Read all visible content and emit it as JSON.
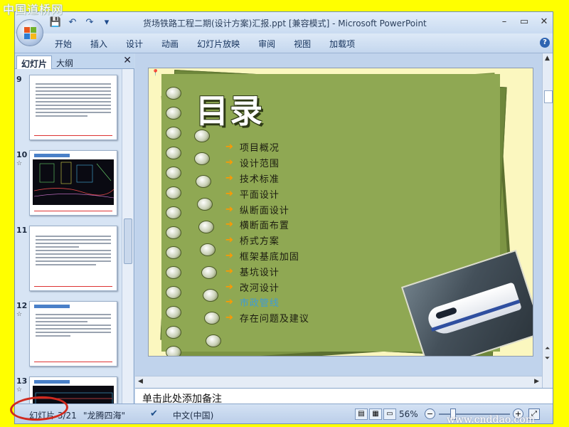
{
  "watermark": {
    "top_left": "中国道桥网",
    "bottom_right": "www.cnddao.com"
  },
  "window": {
    "title": "货场铁路工程二期(设计方案)汇报.ppt [兼容模式] - Microsoft PowerPoint",
    "controls": [
      "–",
      "▭",
      "✕"
    ]
  },
  "ribbon": {
    "tabs": [
      "开始",
      "插入",
      "设计",
      "动画",
      "幻灯片放映",
      "审阅",
      "视图",
      "加载项"
    ]
  },
  "pane": {
    "tabs": [
      "幻灯片",
      "大纲"
    ],
    "slides": [
      {
        "num": "9",
        "star": ""
      },
      {
        "num": "10",
        "star": "☆"
      },
      {
        "num": "11",
        "star": ""
      },
      {
        "num": "12",
        "star": "☆"
      },
      {
        "num": "13",
        "star": "☆"
      }
    ]
  },
  "slide": {
    "title": "目录",
    "items": [
      "项目概况",
      "设计范围",
      "技术标准",
      "平面设计",
      "纵断面设计",
      "横断面布置",
      "桥式方案",
      "框架基底加固",
      "基坑设计",
      "改河设计",
      "市政管线",
      "存在问题及建议"
    ],
    "current_index": 10
  },
  "notes": {
    "placeholder": "单击此处添加备注"
  },
  "status": {
    "slide": "幻灯片 3/21",
    "theme": "\"龙腾四海\"",
    "language": "中文(中国)",
    "zoom": "56%",
    "zoom_level": 0.2
  },
  "colors": {
    "accent_orange": "#ff9900",
    "current_item": "#3f9bd6",
    "annotation_red": "#d02a1f"
  }
}
